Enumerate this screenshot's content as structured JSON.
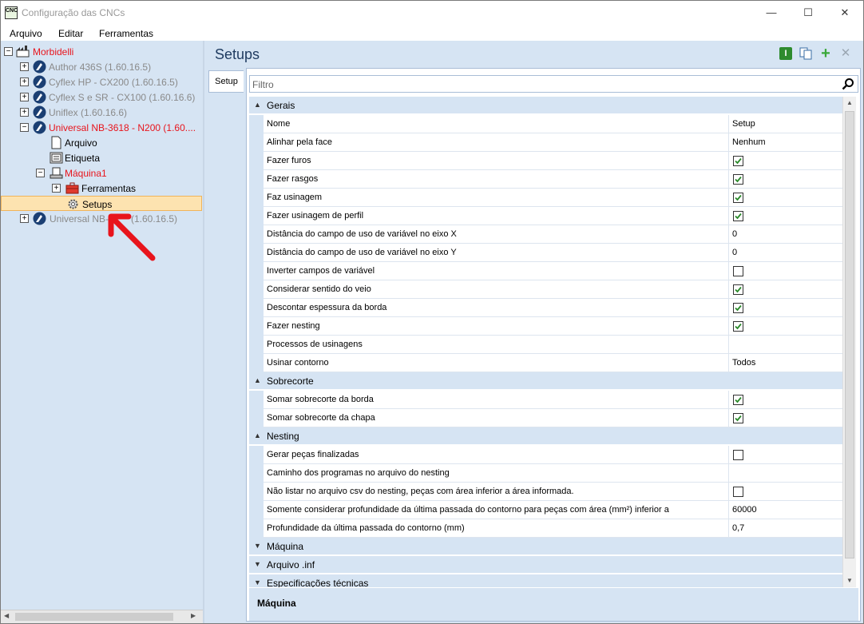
{
  "window": {
    "title": "Configuração das CNCs",
    "icon_text": "CNC",
    "minimize": "—",
    "maximize": "☐",
    "close": "✕"
  },
  "menu": [
    "Arquivo",
    "Editar",
    "Ferramentas"
  ],
  "tree": [
    {
      "label": "Morbidelli",
      "color": "#e8141c",
      "toggle": "⊟",
      "icon": "factory-icon"
    },
    {
      "label": "Author 436S (1.60.16.5)",
      "color": "#8a8a8a",
      "toggle": "+",
      "icon": "machine-logo-icon"
    },
    {
      "label": "Cyflex HP - CX200 (1.60.16.5)",
      "color": "#8a8a8a",
      "toggle": "+",
      "icon": "machine-logo-icon"
    },
    {
      "label": "Cyflex S e SR - CX100 (1.60.16.6)",
      "color": "#8a8a8a",
      "toggle": "+",
      "icon": "machine-logo-icon"
    },
    {
      "label": "Uniflex (1.60.16.6)",
      "color": "#8a8a8a",
      "toggle": "+",
      "icon": "machine-logo-icon"
    },
    {
      "label": "Universal NB-3618 - N200 (1.60....",
      "color": "#e8141c",
      "toggle": "−",
      "icon": "machine-logo-icon"
    },
    {
      "label": "Arquivo",
      "color": "#000000",
      "toggle": "",
      "icon": "file-icon"
    },
    {
      "label": "Etiqueta",
      "color": "#000000",
      "toggle": "",
      "icon": "label-icon"
    },
    {
      "label": "Máquina1",
      "color": "#e8141c",
      "toggle": "−",
      "icon": "machine-icon"
    },
    {
      "label": "Ferramentas",
      "color": "#000000",
      "toggle": "+",
      "icon": "toolbox-icon"
    },
    {
      "label": "Setups",
      "color": "#000000",
      "toggle": "",
      "icon": "gear-icon",
      "selected": true
    },
    {
      "label": "Universal NB-",
      "label_tail": "(1.60.16.5)",
      "color": "#8a8a8a",
      "toggle": "+",
      "icon": "machine-logo-icon"
    }
  ],
  "right": {
    "title": "Setups",
    "side_tab": "Setup",
    "filter_placeholder": "Filtro",
    "description_title": "Máquina"
  },
  "grid": [
    {
      "type": "cat",
      "label": "Gerais",
      "expanded": true
    },
    {
      "type": "prop",
      "name": "Nome",
      "value": "Setup"
    },
    {
      "type": "prop",
      "name": "Alinhar pela face",
      "value": "Nenhum"
    },
    {
      "type": "prop",
      "name": "Fazer furos",
      "check": true
    },
    {
      "type": "prop",
      "name": "Fazer rasgos",
      "check": true
    },
    {
      "type": "prop",
      "name": "Faz usinagem",
      "check": true
    },
    {
      "type": "prop",
      "name": "Fazer usinagem de perfil",
      "check": true
    },
    {
      "type": "prop",
      "name": "Distância do campo de uso de variável no eixo X",
      "value": "0"
    },
    {
      "type": "prop",
      "name": "Distância do campo de uso de variável no eixo Y",
      "value": "0"
    },
    {
      "type": "prop",
      "name": "Inverter campos de variável",
      "check": false
    },
    {
      "type": "prop",
      "name": "Considerar sentido do veio",
      "check": true
    },
    {
      "type": "prop",
      "name": "Descontar espessura da borda",
      "check": true
    },
    {
      "type": "prop",
      "name": "Fazer nesting",
      "check": true
    },
    {
      "type": "prop",
      "name": "Processos de usinagens",
      "value": ""
    },
    {
      "type": "prop",
      "name": "Usinar contorno",
      "value": "Todos"
    },
    {
      "type": "cat",
      "label": "Sobrecorte",
      "expanded": true
    },
    {
      "type": "prop",
      "name": "Somar sobrecorte da borda",
      "check": true
    },
    {
      "type": "prop",
      "name": "Somar sobrecorte da chapa",
      "check": true
    },
    {
      "type": "cat",
      "label": "Nesting",
      "expanded": true
    },
    {
      "type": "prop",
      "name": "Gerar peças finalizadas",
      "check": false
    },
    {
      "type": "prop",
      "name": "Caminho dos programas no arquivo do nesting",
      "value": ""
    },
    {
      "type": "prop",
      "name": "Não listar no arquivo csv do nesting, peças com área inferior a área informada.",
      "check": false
    },
    {
      "type": "prop",
      "name": "Somente considerar profundidade da última passada do contorno para peças com área (mm²) inferior a",
      "value": "60000"
    },
    {
      "type": "prop",
      "name": "Profundidade da última passada do contorno (mm)",
      "value": "0,7"
    },
    {
      "type": "cat",
      "label": "Máquina",
      "expanded": false
    },
    {
      "type": "cat",
      "label": "Arquivo .inf",
      "expanded": false
    },
    {
      "type": "cat",
      "label": "Especificações técnicas",
      "expanded": false
    }
  ]
}
